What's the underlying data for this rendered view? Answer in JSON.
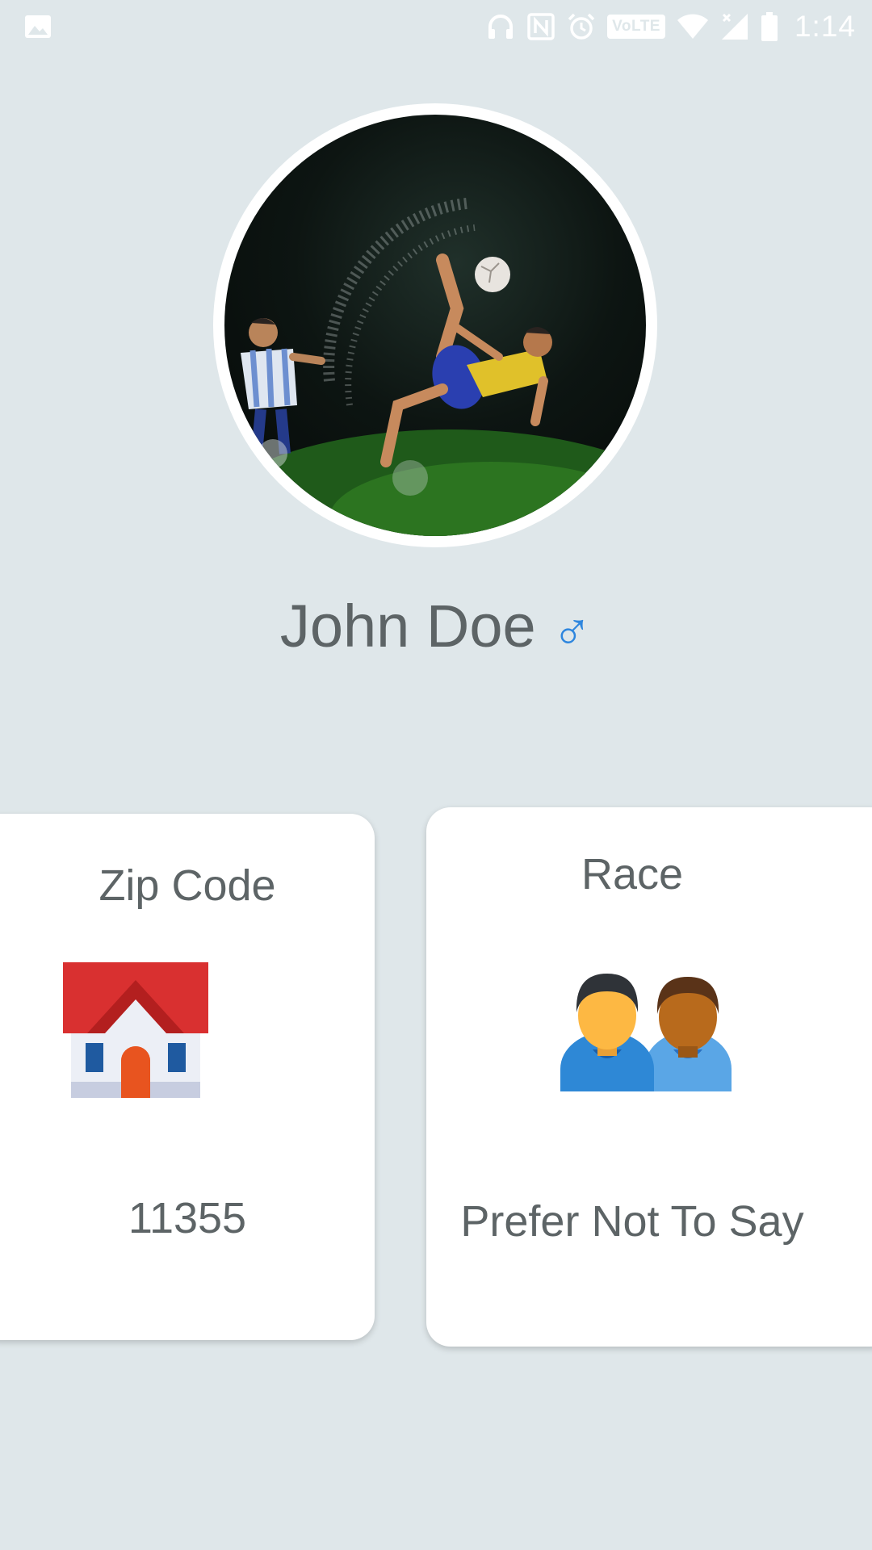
{
  "status_bar": {
    "time": "1:14",
    "network_badge": "VoLTE",
    "icons": [
      "image-icon",
      "headphones-icon",
      "nfc-icon",
      "alarm-icon",
      "volte-icon",
      "wifi-icon",
      "signal-icon",
      "battery-icon"
    ]
  },
  "profile": {
    "avatar_icon": "profile-photo",
    "name": "John Doe",
    "gender_symbol": "♂"
  },
  "cards": {
    "zip": {
      "title": "Zip Code",
      "icon": "house-icon",
      "value": "11355"
    },
    "race": {
      "title": "Race",
      "icon": "people-icon",
      "value": "Prefer Not To Say"
    }
  },
  "colors": {
    "background": "#dfe7ea",
    "card": "#ffffff",
    "text": "#5d6466",
    "gender_accent": "#2e86de"
  }
}
